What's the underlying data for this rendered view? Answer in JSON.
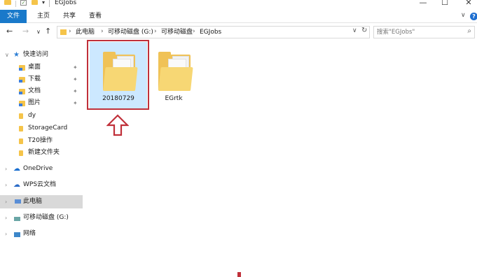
{
  "window": {
    "title": "EGJobs",
    "quick_access_arrow": "▾",
    "minimize": "—",
    "maximize": "☐",
    "close": "✕"
  },
  "ribbon": {
    "file_tab": "文件",
    "tabs": [
      "主页",
      "共享",
      "查看"
    ],
    "collapse_glyph": "∨",
    "help_glyph": "?"
  },
  "navigation": {
    "back": "←",
    "forward": "→",
    "recent": "∨",
    "up": "↑",
    "address_crumbs": [
      "此电脑",
      "可移动磁盘 (G:)",
      "可移动磁盘",
      "EGJobs"
    ],
    "crumb_separator": "›",
    "address_dropdown": "∨",
    "refresh": "↻",
    "search_placeholder": "搜索\"EGJobs\"",
    "search_icon": "⌕"
  },
  "sidebar": {
    "quick_access": {
      "label": "快速访问",
      "chevron": "∨",
      "icon": "star-icon"
    },
    "quick_items": [
      {
        "label": "桌面",
        "pinned": true
      },
      {
        "label": "下载",
        "pinned": true
      },
      {
        "label": "文档",
        "pinned": true
      },
      {
        "label": "图片",
        "pinned": true
      },
      {
        "label": "dy",
        "pinned": false
      },
      {
        "label": "StorageCard",
        "pinned": false
      },
      {
        "label": "T20操作",
        "pinned": false
      },
      {
        "label": "新建文件夹",
        "pinned": false
      }
    ],
    "pin_glyph": "✦",
    "roots": [
      {
        "label": "OneDrive",
        "chevron": "›",
        "icon": "onedrive-icon"
      },
      {
        "label": "WPS云文档",
        "chevron": "›",
        "icon": "wps-cloud-icon"
      },
      {
        "label": "此电脑",
        "chevron": "›",
        "icon": "this-pc-icon",
        "selected": true
      },
      {
        "label": "可移动磁盘 (G:)",
        "chevron": "›",
        "icon": "removable-drive-icon"
      },
      {
        "label": "网络",
        "chevron": "›",
        "icon": "network-icon"
      }
    ]
  },
  "content": {
    "items": [
      {
        "name": "20180729",
        "type": "folder",
        "selected": true
      },
      {
        "name": "EGrtk",
        "type": "folder",
        "selected": false
      }
    ]
  },
  "annotation": {
    "highlight_color": "#c0303a",
    "arrow_direction": "up"
  },
  "colors": {
    "accent": "#1979ca",
    "selection": "#cce8ff",
    "folder": "#f0c257"
  }
}
